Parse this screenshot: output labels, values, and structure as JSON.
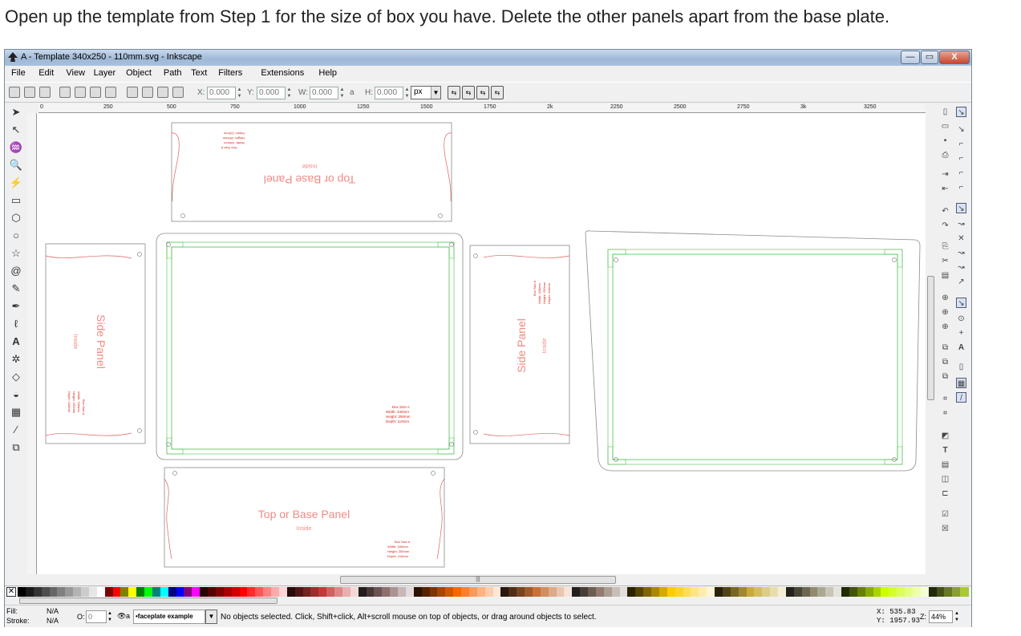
{
  "caption": "Open up the template from Step 1 for the size of box you have. Delete the other panels apart from the base plate.",
  "window": {
    "title": "A - Template 340x250 - 110mm.svg - Inkscape",
    "minimize": "—",
    "maximize": "▭",
    "close": "X"
  },
  "menu": [
    {
      "label": "File"
    },
    {
      "label": "Edit"
    },
    {
      "label": "View"
    },
    {
      "label": "Layer"
    },
    {
      "label": "Object"
    },
    {
      "label": "Path"
    },
    {
      "label": "Text"
    },
    {
      "label": "Filters"
    },
    {
      "label": "Extensions"
    },
    {
      "label": "Help"
    }
  ],
  "toolbar": {
    "x_label": "X:",
    "x_value": "0.000",
    "y_label": "Y:",
    "y_value": "0.000",
    "w_label": "W:",
    "w_value": "0.000",
    "h_label": "H:",
    "h_value": "0.000",
    "unit": "px"
  },
  "ruler": {
    "ticks": [
      "0",
      "250",
      "500",
      "750",
      "1000",
      "1250",
      "1500",
      "1750",
      "2k",
      "2250",
      "2500",
      "2750",
      "3k",
      "3250"
    ]
  },
  "canvas": {
    "top_panel": {
      "title": "Top or Base Panel",
      "sub": "Inside",
      "box": "Box Size A",
      "w": "Width:    340mm",
      "h": "Height:  250mm",
      "d": "Depth:    110mm"
    },
    "base_panel": {
      "title": "Top or Base Panel",
      "sub": "Inside",
      "box": "Box Size A",
      "w": "Width:    340mm",
      "h": "Height:  250mm",
      "d": "Depth:    110mm"
    },
    "left_side": {
      "title": "Side Panel",
      "sub": "Inside",
      "box": "Box Size A",
      "w": "Width:    340mm",
      "h": "Height:  250mm",
      "d": "Depth:    110mm"
    },
    "right_side": {
      "title": "Side Panel",
      "sub": "Inside",
      "box": "Box Size A",
      "w": "Width:    340mm",
      "h": "Height:  250mm",
      "d": "Depth:    110mm"
    },
    "center": {
      "box": "Box Size A",
      "w": "Width:     340mm",
      "h": "Height:   250mm",
      "d": "Depth:     110mm"
    }
  },
  "status": {
    "fill_label": "Fill:",
    "fill_value": "N/A",
    "stroke_label": "Stroke:",
    "stroke_value": "N/A",
    "opacity_label": "O:",
    "opacity_value": "0",
    "layer": "•faceplate example",
    "message": "No objects selected. Click, Shift+click, Alt+scroll mouse on top of objects, or drag around objects to select.",
    "x_coord": "X:  535.83",
    "y_coord": "Y: 1957.93",
    "zoom_label": "Z:",
    "zoom": "44%"
  },
  "colors": {
    "panel_text": "#f08a84",
    "panel_small": "#d9241c",
    "outline": "#8a8a8a",
    "green": "#4cc14c",
    "curve": "#e06060"
  },
  "palette": [
    "#000000",
    "#1a1a1a",
    "#333333",
    "#4d4d4d",
    "#666666",
    "#808080",
    "#999999",
    "#b3b3b3",
    "#cccccc",
    "#e6e6e6",
    "#ffffff",
    "#800000",
    "#ff0000",
    "#808000",
    "#ffff00",
    "#008000",
    "#00ff00",
    "#008080",
    "#00ffff",
    "#000080",
    "#0000ff",
    "#800080",
    "#ff00ff",
    "#2b0000",
    "#550000",
    "#800000",
    "#aa0000",
    "#d40000",
    "#ff0000",
    "#ff2a2a",
    "#ff5555",
    "#ff8080",
    "#ffaaaa",
    "#ffd5d5",
    "#280b0b",
    "#501616",
    "#782121",
    "#a02c2c",
    "#c83737",
    "#d35f5f",
    "#de8787",
    "#e9afaf",
    "#f4d7d7",
    "#241c1c",
    "#483737",
    "#6c5353",
    "#916f6f",
    "#ac9393",
    "#c8b7b7",
    "#e3dbdb",
    "#2b1100",
    "#552200",
    "#803300",
    "#aa4400",
    "#d45500",
    "#ff6600",
    "#ff7f2a",
    "#ff9955",
    "#ffb380",
    "#ffccaa",
    "#ffe6d5",
    "#28170b",
    "#502d16",
    "#784421",
    "#a05a2c",
    "#c87137",
    "#d38d5f",
    "#deaa87",
    "#e9c6af",
    "#f4e3d7",
    "#241f1c",
    "#483e37",
    "#6c5d53",
    "#917c6f",
    "#ac9d93",
    "#c8beb7",
    "#e3dedb",
    "#2b2200",
    "#554400",
    "#806600",
    "#aa8800",
    "#d4aa00",
    "#ffcc00",
    "#ffd42a",
    "#ffdd55",
    "#ffe680",
    "#ffeeaa",
    "#fff6d5",
    "#28220b",
    "#504416",
    "#786721",
    "#a0892c",
    "#c8ab37",
    "#d3bc5f",
    "#decd87",
    "#e9ddaf",
    "#f4eed7",
    "#24221c",
    "#484537",
    "#6c6753",
    "#918a6f",
    "#aca793",
    "#c8c4b7",
    "#e3e2db",
    "#222b00",
    "#445500",
    "#668000",
    "#88aa00",
    "#aad400",
    "#ccff00",
    "#d4ff2a",
    "#ddff55",
    "#e5ff80",
    "#eeffaa",
    "#f6ffd5",
    "#22280b",
    "#445016",
    "#677821",
    "#89a02c",
    "#abc837"
  ]
}
